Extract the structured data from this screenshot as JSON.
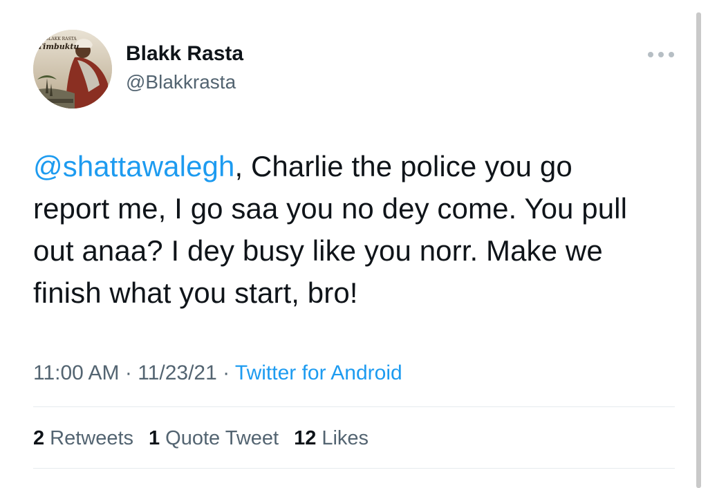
{
  "author": {
    "name": "Blakk Rasta",
    "handle": "@Blakkrasta",
    "avatar_caption_top": "BLAKK RASTA",
    "avatar_caption_title": "Timbuktu"
  },
  "tweet": {
    "mention": "@shattawalegh",
    "text_after_mention": ", Charlie the police you go report me, I go saa you no dey come. You pull out anaa? I dey busy like you norr. Make we finish what you start, bro!"
  },
  "meta": {
    "time": "11:00 AM",
    "separator": "·",
    "date": "11/23/21",
    "source": "Twitter for Android"
  },
  "stats": {
    "retweets_count": "2",
    "retweets_label": "Retweets",
    "quotes_count": "1",
    "quotes_label": "Quote Tweet",
    "likes_count": "12",
    "likes_label": "Likes"
  },
  "colors": {
    "link": "#1d9bf0",
    "secondary_text": "#536471",
    "primary_text": "#0f1419",
    "divider": "#e6ebee"
  },
  "icons": {
    "more": "more-horizontal-icon"
  }
}
